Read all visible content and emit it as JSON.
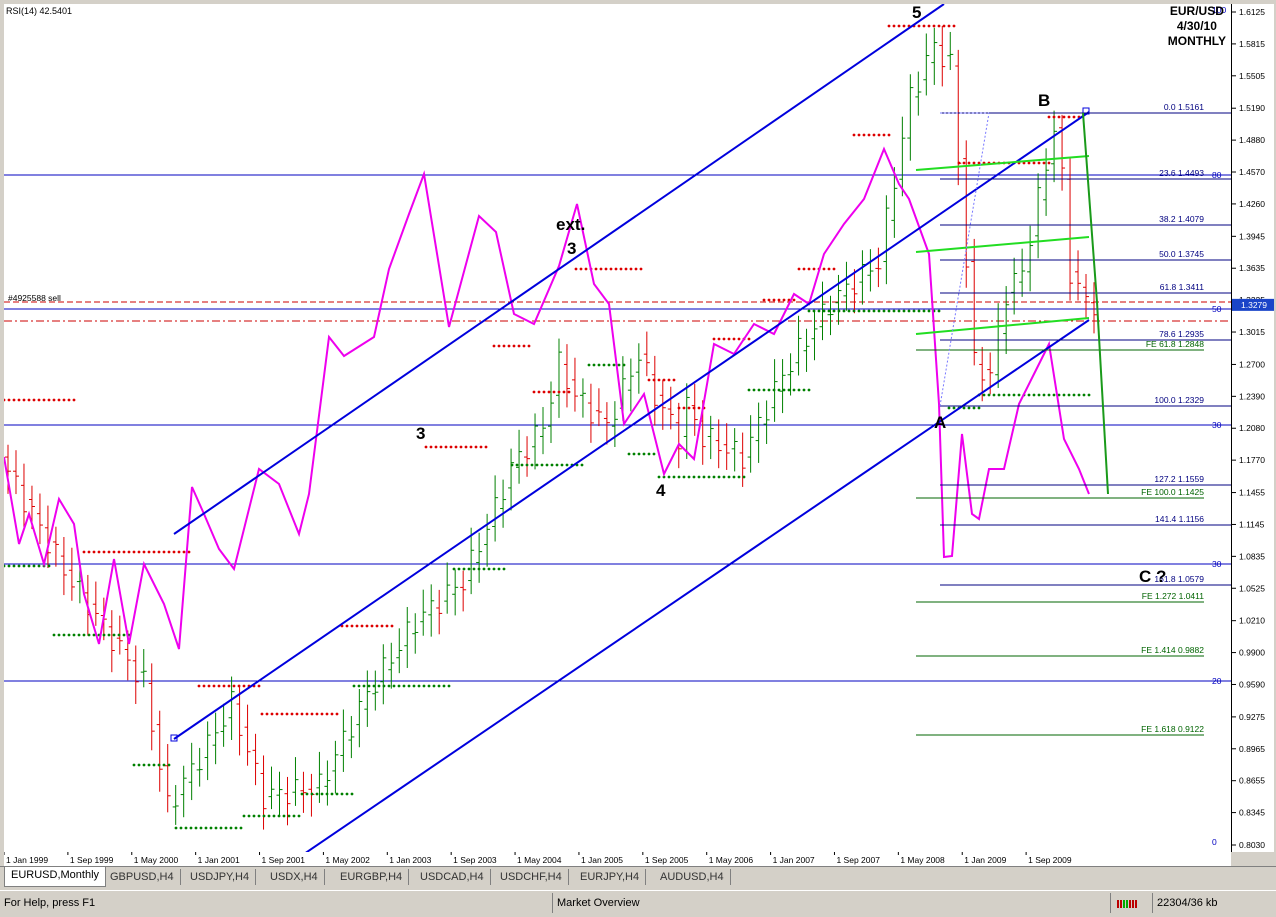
{
  "indicator": "RSI(14) 42.5401",
  "title": {
    "pair": "EUR/USD",
    "date": "4/30/10",
    "tf": "MONTHLY"
  },
  "order_label": "#4925588 sell",
  "chart_data": {
    "type": "line",
    "x_ticks": [
      "1 Jan 1999",
      "1 Sep 1999",
      "1 May 2000",
      "1 Jan 2001",
      "1 Sep 2001",
      "1 May 2002",
      "1 Jan 2003",
      "1 Sep 2003",
      "1 May 2004",
      "1 Jan 2005",
      "1 Sep 2005",
      "1 May 2006",
      "1 Jan 2007",
      "1 Sep 2007",
      "1 May 2008",
      "1 Jan 2009",
      "1 Sep 2009"
    ],
    "y_ticks": [
      "1.6125",
      "1.5815",
      "1.5505",
      "1.5190",
      "1.4880",
      "1.4570",
      "1.4260",
      "1.3945",
      "1.3635",
      "1.3325",
      "1.3015",
      "1.2700",
      "1.2390",
      "1.2080",
      "1.1770",
      "1.1455",
      "1.1145",
      "1.0835",
      "1.0525",
      "1.0210",
      "0.9900",
      "0.9590",
      "0.9275",
      "0.8965",
      "0.8655",
      "0.8345",
      "0.8030"
    ],
    "ylim": [
      0.803,
      1.6125
    ],
    "rsi_levels": [
      "100",
      "80",
      "50",
      "30",
      "20",
      "0"
    ],
    "price_bar": "1.3279",
    "wave_labels": [
      "5",
      "ext.",
      "3",
      "3",
      "4",
      "A",
      "B",
      "C ?"
    ],
    "fib_retracement": [
      {
        "level": "0.0",
        "price": "1.5161"
      },
      {
        "level": "23.6",
        "price": "1.4493"
      },
      {
        "level": "38.2",
        "price": "1.4079"
      },
      {
        "level": "50.0",
        "price": "1.3745"
      },
      {
        "level": "61.8",
        "price": "1.3411"
      },
      {
        "level": "78.6",
        "price": "1.2935"
      },
      {
        "level": "100.0",
        "price": "1.2329"
      },
      {
        "level": "127.2",
        "price": "1.1559"
      },
      {
        "level": "141.4",
        "price": "1.1156"
      },
      {
        "level": "161.8",
        "price": "1.0579"
      }
    ],
    "fib_expansion": [
      {
        "level": "FE 61.8",
        "price": "1.2848"
      },
      {
        "level": "FE 100.0",
        "price": "1.1425"
      },
      {
        "level": "FE 1.272",
        "price": "1.0411"
      },
      {
        "level": "FE 1.414",
        "price": "0.9882"
      },
      {
        "level": "FE 1.618",
        "price": "0.9122"
      }
    ]
  },
  "tabs": [
    "EURUSD,Monthly",
    "GBPUSD,H4",
    "USDJPY,H4",
    "USDX,H4",
    "EURGBP,H4",
    "USDCAD,H4",
    "USDCHF,H4",
    "EURJPY,H4",
    "AUDUSD,H4"
  ],
  "status": {
    "help": "For Help, press F1",
    "profile": "Market Overview",
    "traffic": "22304/36 kb"
  },
  "colors": {
    "channel": "#0000dd",
    "rsi": "#ee00ee",
    "bull": "#008000",
    "bear": "#dd0000",
    "fib": "#000080",
    "fe": "#006400",
    "wave": "#00cc00"
  }
}
